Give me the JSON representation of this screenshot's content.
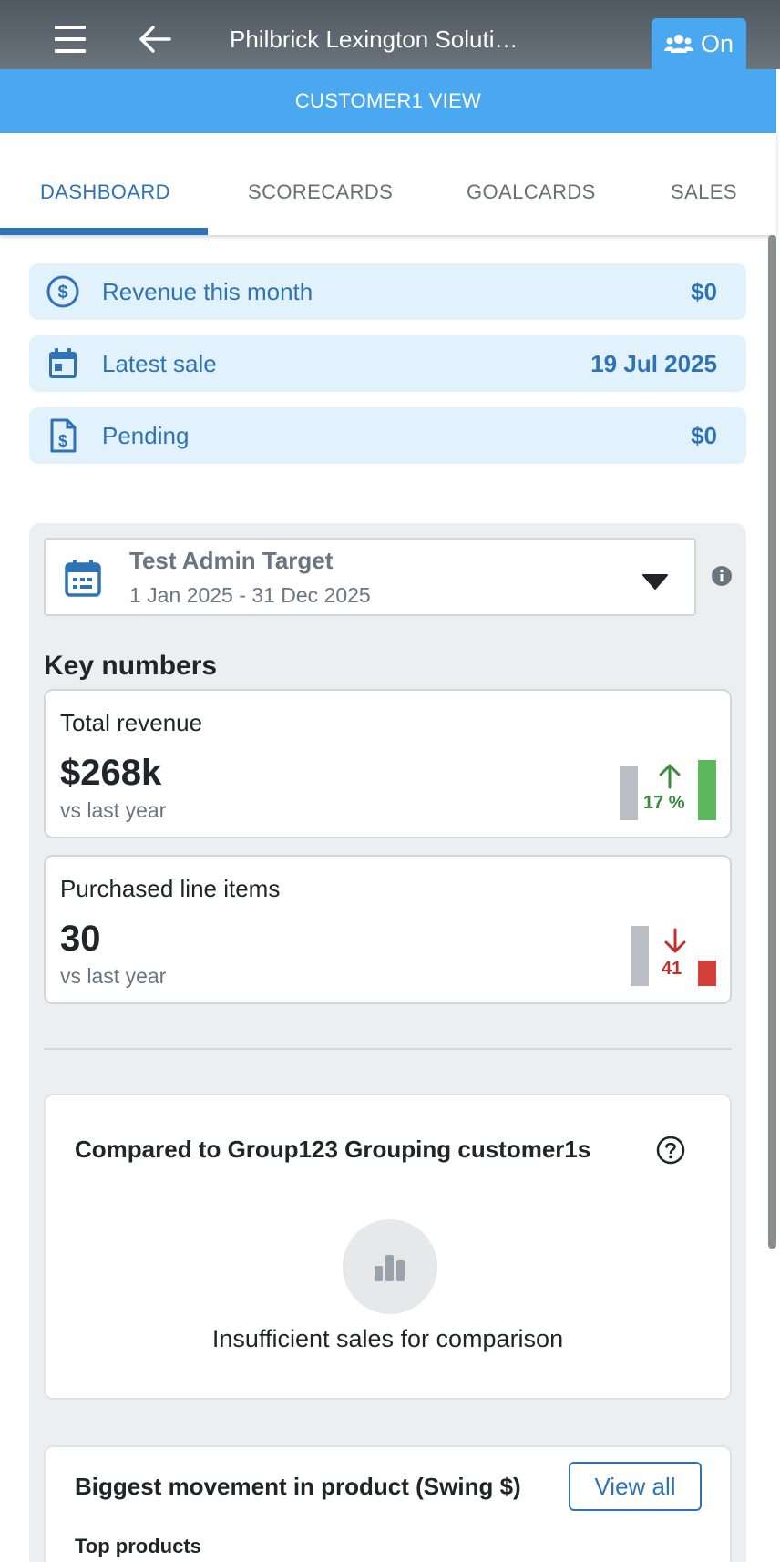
{
  "appbar": {
    "title": "Philbrick Lexington Soluti…",
    "on_label": "On",
    "icons": [
      "menu-icon",
      "back-arrow-icon",
      "users-icon"
    ]
  },
  "banner": {
    "label": "CUSTOMER1 VIEW"
  },
  "tabs": [
    {
      "label": "DASHBOARD",
      "active": true
    },
    {
      "label": "SCORECARDS",
      "active": false
    },
    {
      "label": "GOALCARDS",
      "active": false
    },
    {
      "label": "SALES",
      "active": false
    }
  ],
  "summary": [
    {
      "icon": "dollar-circle-icon",
      "label": "Revenue this month",
      "value": "$0"
    },
    {
      "icon": "calendar-icon",
      "label": "Latest sale",
      "value": "19 Jul 2025"
    },
    {
      "icon": "invoice-dollar-icon",
      "label": "Pending",
      "value": "$0"
    }
  ],
  "target": {
    "name": "Test Admin Target",
    "range": "1 Jan 2025 - 31 Dec 2025"
  },
  "key_numbers": {
    "title": "Key numbers",
    "cards": [
      {
        "label": "Total revenue",
        "value": "$268k",
        "sub": "vs last year",
        "change": "17 %",
        "direction": "up",
        "color": "#5cb85c",
        "arrow_color": "#3c8a3c"
      },
      {
        "label": "Purchased line items",
        "value": "30",
        "sub": "vs last year",
        "change": "41",
        "direction": "down",
        "color": "#d2403a",
        "arrow_color": "#c0302a"
      }
    ]
  },
  "comparison": {
    "title": "Compared to Group123 Grouping customer1s",
    "message": "Insufficient sales for comparison"
  },
  "products": {
    "title": "Biggest movement in product (Swing $)",
    "view_all": "View all",
    "subheading": "Top products"
  },
  "colors": {
    "primary": "#2e73b8",
    "banner": "#4aa8f0",
    "summary_bg": "#e2f2fc",
    "panel_bg": "#eceef1"
  }
}
